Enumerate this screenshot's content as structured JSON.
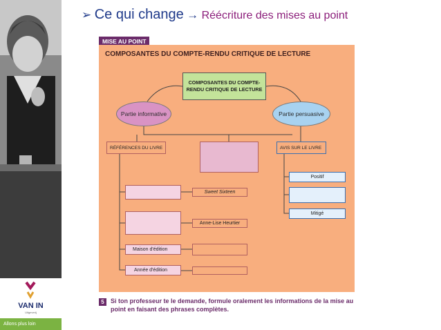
{
  "slide": {
    "title_main": "Ce qui change",
    "title_sub": "Réécriture des mises au point"
  },
  "sidebar": {
    "logo_text": "VAN IN",
    "logo_sub": "Uitgeverij",
    "tagline": "Allons plus loin"
  },
  "figure": {
    "badge": "MISE AU POINT",
    "title": "COMPOSANTES DU COMPTE-RENDU CRITIQUE DE LECTURE",
    "center_box": "COMPOSANTES DU COMPTE-RENDU CRITIQUE DE LECTURE",
    "oval_left": "Partie informative",
    "oval_right": "Partie persuasive",
    "left_branch": "RÉFÉRENCES DU LIVRE",
    "right_branch": "AVIS SUR LE LIVRE",
    "ref_items": [
      "",
      "",
      "Maison d'édition",
      "Année d'édition"
    ],
    "ref_values": [
      "Sweet Sixteen",
      "Anne-Lise Heurtier",
      "",
      ""
    ],
    "avis_items": [
      "Positif",
      "",
      "Mitigé"
    ]
  },
  "question": {
    "number": "5",
    "text": "Si ton professeur te le demande, formule oralement les informations de la mise au point en faisant des phrases complètes."
  },
  "colors": {
    "panel": "#f8ae7e",
    "title_blue": "#1f3a8a",
    "title_purple": "#8b1d7a",
    "badge_purple": "#6b2c6a",
    "center_green": "#c3e39a",
    "oval_pink": "#d993c4",
    "oval_blue": "#a8d2f0"
  }
}
